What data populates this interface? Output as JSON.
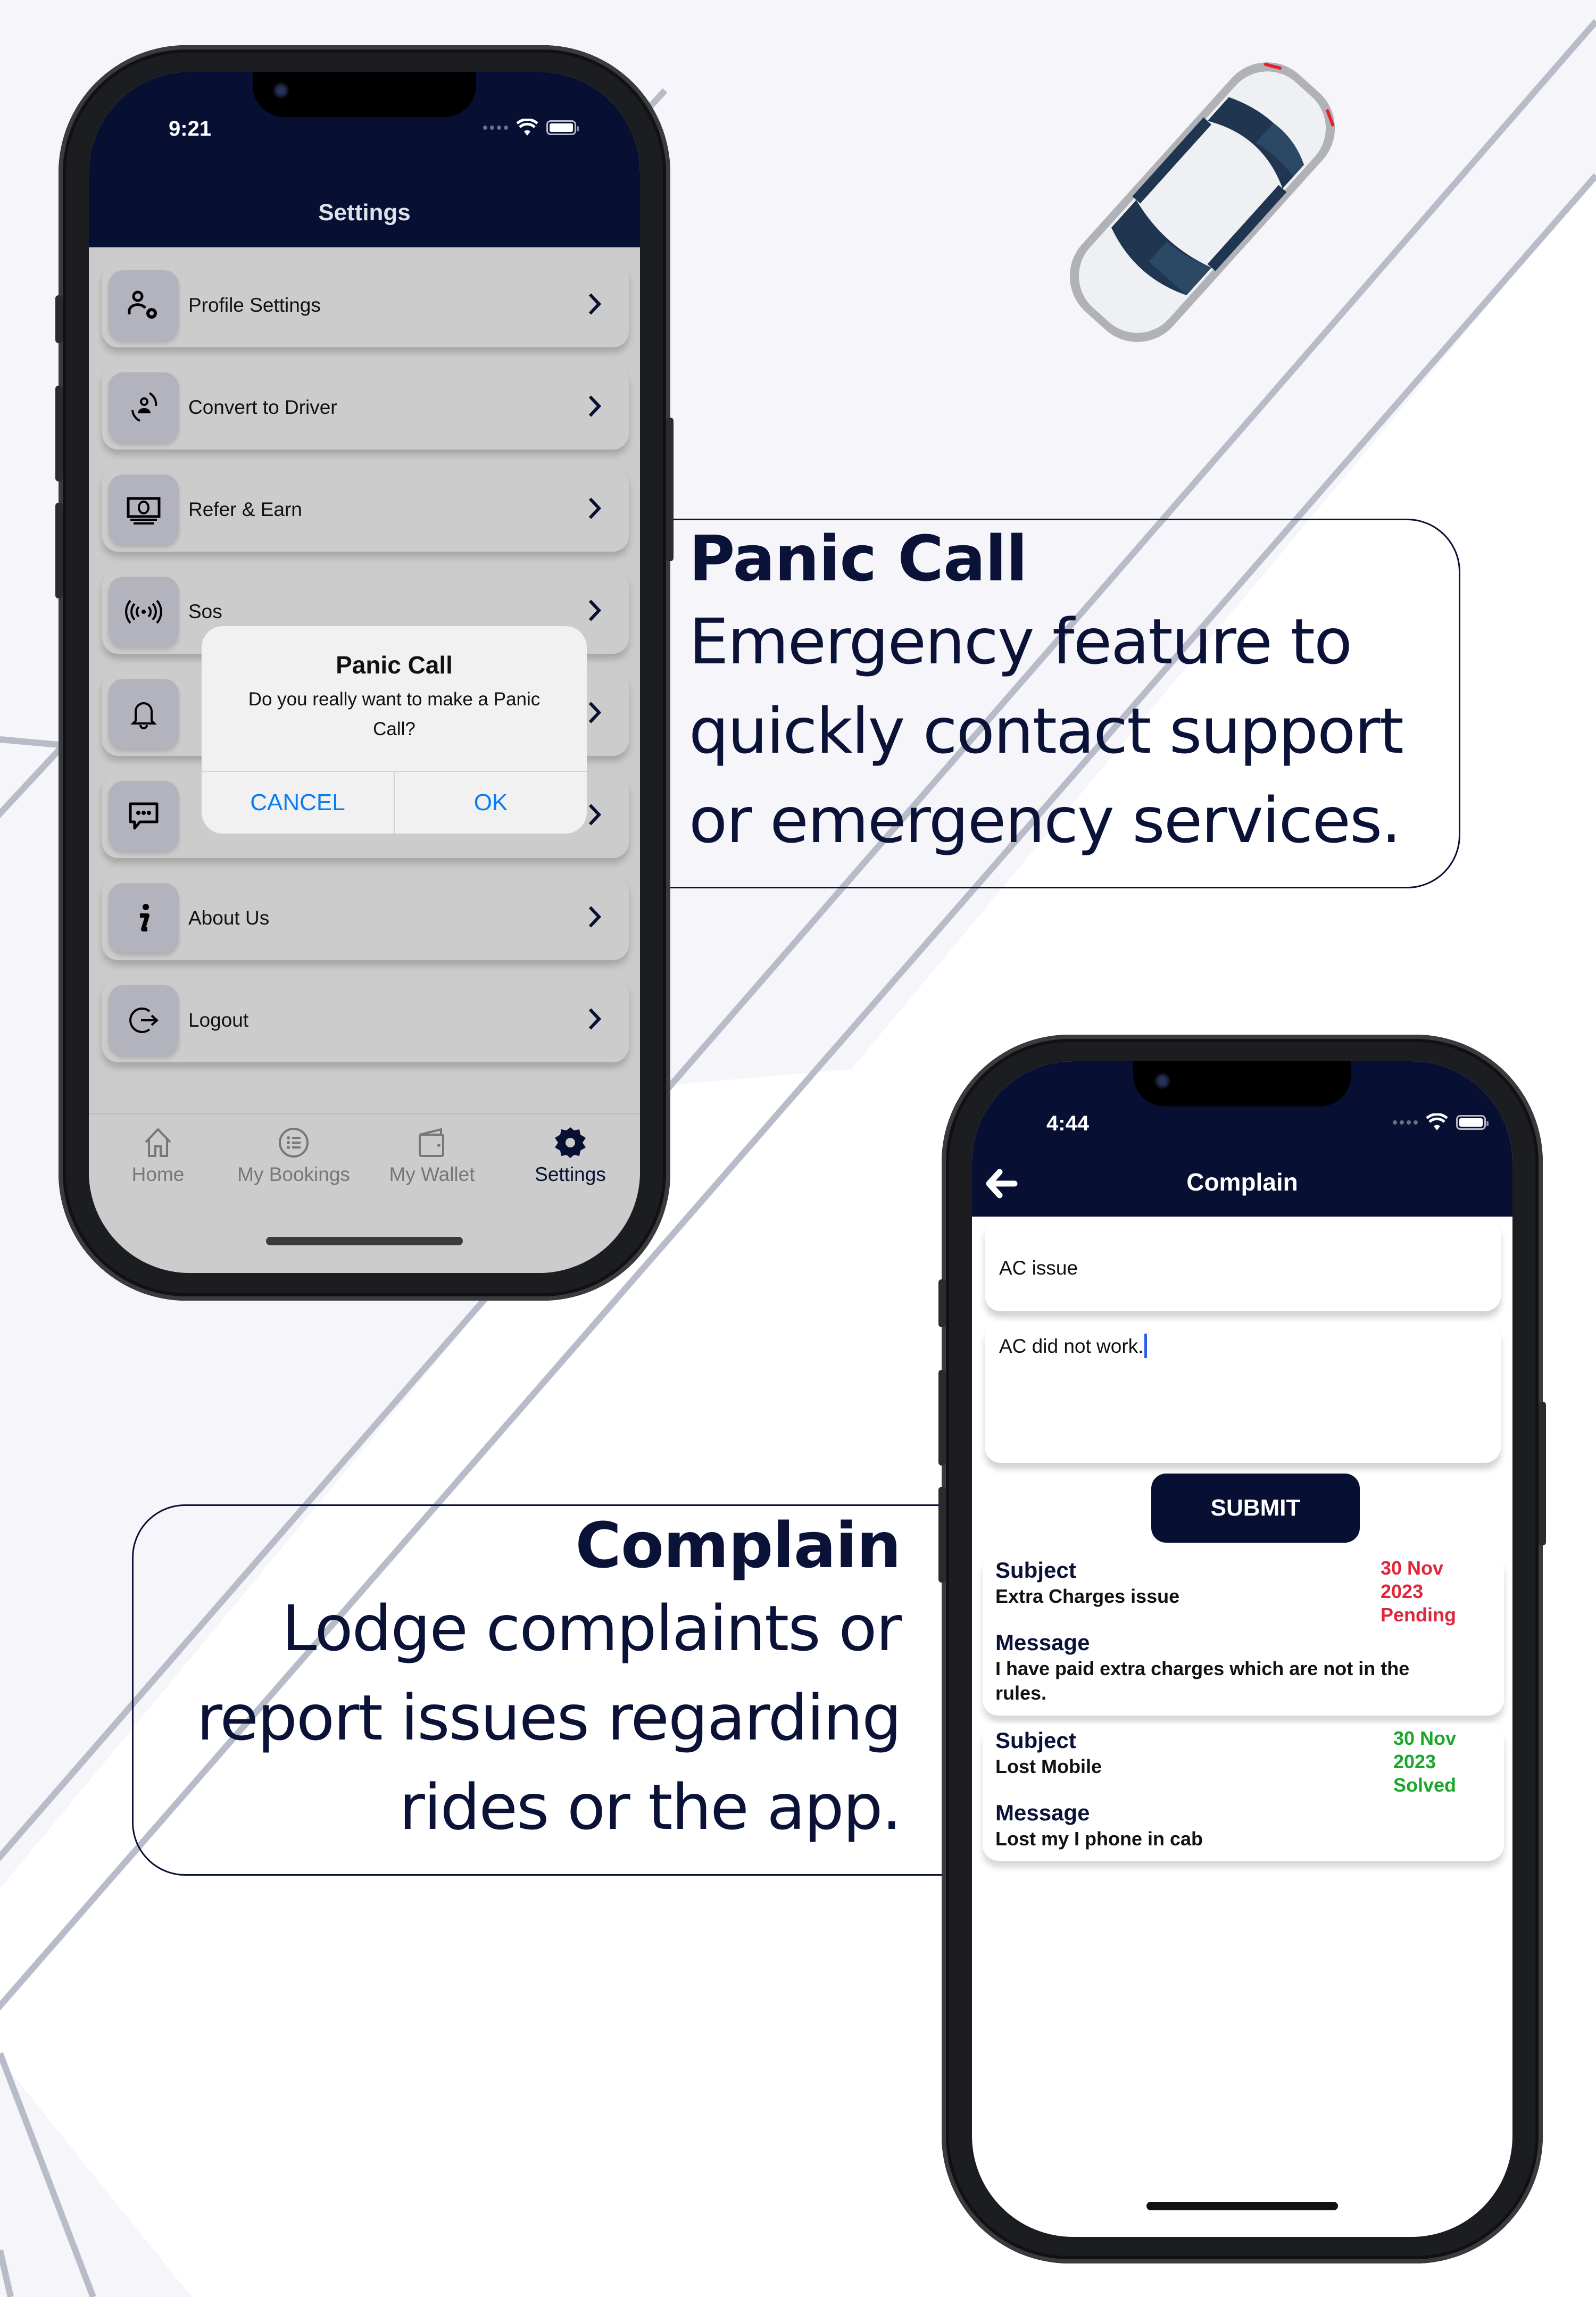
{
  "colors": {
    "brand_navy": "#071033",
    "link_blue": "#0a7cf3",
    "pending_red": "#e0263a",
    "solved_green": "#1aa82a",
    "caption_text": "#0b1238"
  },
  "captions": {
    "panic": {
      "title": "Panic Call",
      "lines": [
        "Emergency feature to",
        "quickly contact support",
        "or emergency services."
      ]
    },
    "complain": {
      "title": "Complain",
      "lines": [
        "Lodge complaints or",
        "report issues regarding",
        "rides or the app."
      ]
    }
  },
  "phone_settings": {
    "status": {
      "time": "9:21"
    },
    "header": {
      "title": "Settings"
    },
    "items": [
      {
        "label": "Profile Settings",
        "icon": "user-gear-icon"
      },
      {
        "label": "Convert to Driver",
        "icon": "user-switch-icon"
      },
      {
        "label": "Refer & Earn",
        "icon": "cash-icon"
      },
      {
        "label": "Sos",
        "icon": "broadcast-icon"
      },
      {
        "label": "",
        "icon": "bell-icon"
      },
      {
        "label": "",
        "icon": "chat-icon"
      },
      {
        "label": "About Us",
        "icon": "info-icon"
      },
      {
        "label": "Logout",
        "icon": "logout-icon"
      }
    ],
    "dialog": {
      "title": "Panic Call",
      "message": "Do you really want to make a Panic Call?",
      "cancel": "CANCEL",
      "ok": "OK"
    },
    "tabs": [
      {
        "label": "Home",
        "icon": "home-icon",
        "active": false
      },
      {
        "label": "My Bookings",
        "icon": "list-icon",
        "active": false
      },
      {
        "label": "My Wallet",
        "icon": "wallet-icon",
        "active": false
      },
      {
        "label": "Settings",
        "icon": "gear-icon",
        "active": true
      }
    ]
  },
  "phone_complain": {
    "status": {
      "time": "4:44"
    },
    "header": {
      "title": "Complain",
      "back": "back-arrow-icon"
    },
    "form": {
      "subject_value": "AC issue",
      "message_value": "AC did not work.",
      "submit": "SUBMIT"
    },
    "complaints": [
      {
        "subject_label": "Subject",
        "subject": "Extra Charges issue",
        "date_line1": "30 Nov",
        "date_line2": "2023",
        "status": "Pending",
        "message_label": "Message",
        "message": "I have paid extra charges which are not in the rules."
      },
      {
        "subject_label": "Subject",
        "subject": "Lost Mobile",
        "date_line1": "30 Nov",
        "date_line2": "2023",
        "status": "Solved",
        "message_label": "Message",
        "message": "Lost my I phone in cab"
      }
    ]
  }
}
